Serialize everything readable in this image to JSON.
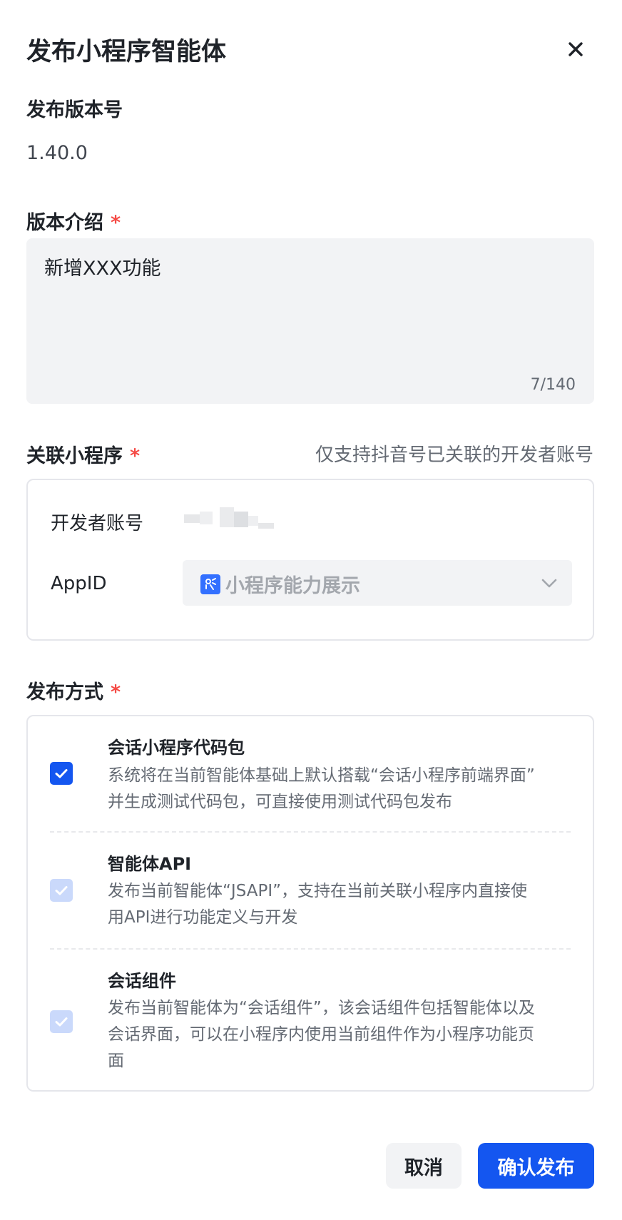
{
  "dialog": {
    "title": "发布小程序智能体",
    "close_icon": "close-icon"
  },
  "version": {
    "label": "发布版本号",
    "value": "1.40.0"
  },
  "intro": {
    "label": "版本介绍",
    "required": "*",
    "value": "新增XXX功能",
    "counter": "7/140"
  },
  "miniprogram": {
    "label": "关联小程序",
    "required": "*",
    "hint": "仅支持抖音号已关联的开发者账号",
    "developer_label": "开发者账号",
    "appid_label": "AppID",
    "appid_value": "小程序能力展示",
    "app_icon": "miniprogram-icon",
    "dropdown_icon": "chevron-down-icon"
  },
  "publish": {
    "label": "发布方式",
    "required": "*",
    "options": [
      {
        "title": "会话小程序代码包",
        "desc_line1": "系统将在当前智能体基础上默认搭载“会话小程序前端界面”",
        "desc_line2": "并生成测试代码包，可直接使用测试代码包发布",
        "checked": true,
        "disabled": false
      },
      {
        "title": "智能体API",
        "desc_line1": "发布当前智能体“JSAPI”，支持在当前关联小程序内直接使",
        "desc_line2": "用API进行功能定义与开发",
        "checked": true,
        "disabled": true
      },
      {
        "title": "会话组件",
        "desc_line1": "发布当前智能体为“会话组件”，该会话组件包括智能体以及",
        "desc_line2": "会话界面，可以在小程序内使用当前组件作为小程序功能页",
        "desc_line3": "面",
        "checked": true,
        "disabled": true
      }
    ]
  },
  "footer": {
    "cancel_label": "取消",
    "confirm_label": "确认发布"
  },
  "colors": {
    "primary": "#1456f0",
    "required": "#f54a45",
    "disabled_check": "#cad9fb"
  }
}
